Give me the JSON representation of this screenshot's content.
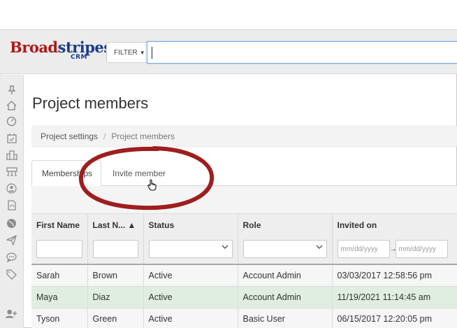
{
  "header": {
    "logo_text_a": "Broad",
    "logo_text_b": "stripes",
    "logo_sub": "CRM",
    "filter_label": "FILTER",
    "search_value": ""
  },
  "sidebar": {
    "icons": [
      "pin-icon",
      "home-icon",
      "dashboard-icon",
      "calendar-check-icon",
      "buildings-icon",
      "org-chart-icon",
      "contacts-icon",
      "pdf-icon",
      "globe-icon",
      "send-icon",
      "chat-icon",
      "tag-icon",
      "add-user-icon"
    ]
  },
  "page": {
    "title": "Project members",
    "breadcrumb": [
      "Project settings",
      "Project members"
    ],
    "tabs": [
      {
        "label": "Memberships",
        "active": true
      },
      {
        "label": "Invite member",
        "active": false
      }
    ]
  },
  "table": {
    "columns": [
      "First Name",
      "Last N... ▲",
      "Status",
      "Role",
      "Invited on"
    ],
    "date_placeholder": "mm/dd/yyyy",
    "rows": [
      {
        "first": "Sarah",
        "last": "Brown",
        "status": "Active",
        "role": "Account Admin",
        "invited": "03/03/2017 12:58:56 pm"
      },
      {
        "first": "Maya",
        "last": "Diaz",
        "status": "Active",
        "role": "Account Admin",
        "invited": "11/19/2021 11:14:45 am"
      },
      {
        "first": "Tyson",
        "last": "Green",
        "status": "Active",
        "role": "Basic User",
        "invited": "06/15/2017 12:20:05 pm"
      }
    ]
  },
  "colors": {
    "logo_red": "#b01818",
    "logo_blue": "#1c3c8c",
    "annotation_red": "#9e1e1e",
    "selected_row": "#dfeee0"
  }
}
